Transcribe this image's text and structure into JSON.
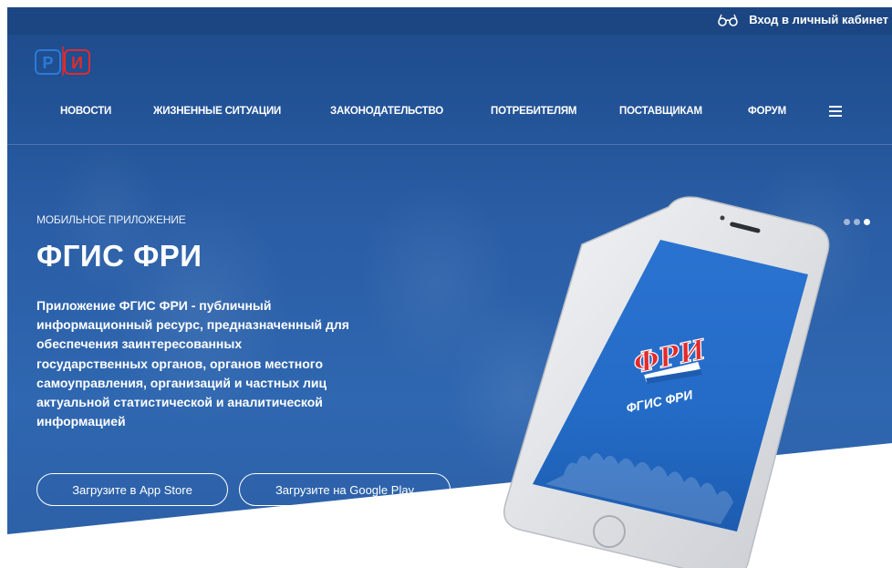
{
  "header": {
    "login_label": "Вход в личный кабинет",
    "logo_letters": [
      "Р",
      "И"
    ]
  },
  "nav": {
    "items": [
      {
        "label": "НОВОСТИ"
      },
      {
        "label": "ЖИЗНЕННЫЕ СИТУАЦИИ"
      },
      {
        "label": "ЗАКОНОДАТЕЛЬСТВО"
      },
      {
        "label": "ПОТРЕБИТЕЛЯМ"
      },
      {
        "label": "ПОСТАВЩИКАМ"
      },
      {
        "label": "ФОРУМ"
      }
    ]
  },
  "hero": {
    "eyebrow": "МОБИЛЬНОЕ ПРИЛОЖЕНИЕ",
    "title": "ФГИС ФРИ",
    "description_lines": [
      "Приложение ФГИС ФРИ - публичный",
      "информационный ресурс, предназначенный для",
      "обеспечения заинтересованных",
      "государственных органов, органов местного",
      "самоуправления, организаций и частных лиц",
      "актуальной статистической и аналитической",
      "информацией"
    ],
    "buttons": {
      "appstore": "Загрузите в App Store",
      "google": "Загрузите на Google Play"
    },
    "slider": {
      "count": 3,
      "active_index": 2
    }
  },
  "phone_screen": {
    "logo_text": "ФРИ",
    "app_name": "ФГИС ФРИ"
  },
  "colors": {
    "topbar": "#1c4682",
    "hero": "#2a5ea6",
    "logo_blue": "#2b7bd6",
    "logo_red": "#e32b2b"
  }
}
